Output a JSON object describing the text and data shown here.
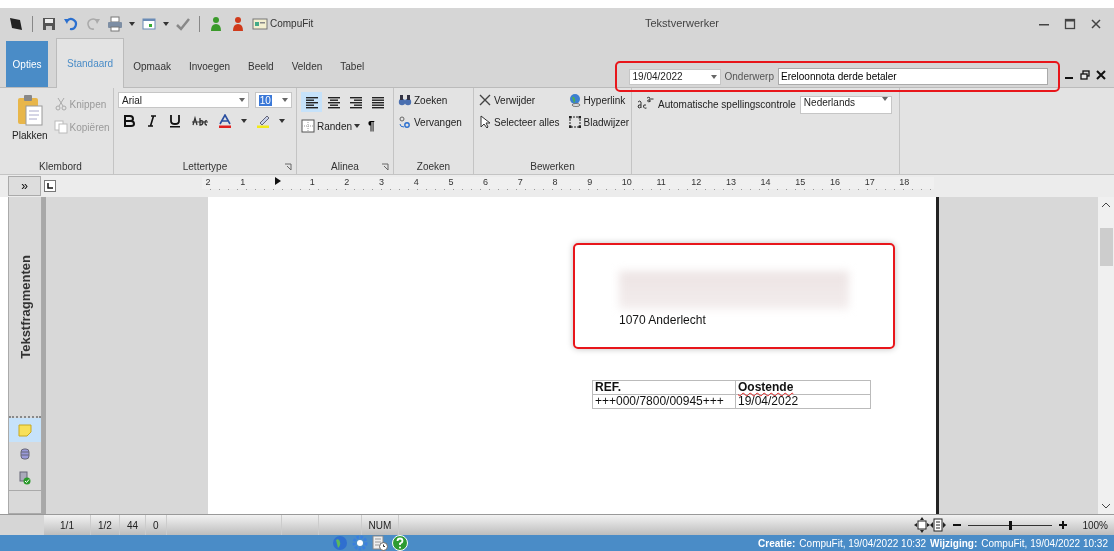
{
  "title_bar": {
    "app_label": "CompuFit",
    "title": "Tekstverwerker"
  },
  "tabs": [
    {
      "label": "Opties",
      "kind": "menu",
      "selected": false
    },
    {
      "label": "Standaard",
      "kind": "tab",
      "selected": true
    },
    {
      "label": "Opmaak",
      "kind": "tab",
      "selected": false
    },
    {
      "label": "Invoegen",
      "kind": "tab",
      "selected": false
    },
    {
      "label": "Beeld",
      "kind": "tab",
      "selected": false
    },
    {
      "label": "Velden",
      "kind": "tab",
      "selected": false
    },
    {
      "label": "Tabel",
      "kind": "tab",
      "selected": false
    }
  ],
  "document_header": {
    "date": "19/04/2022",
    "subject_label": "Onderwerp",
    "subject": "Ereloonnota derde betaler",
    "highlighted": true
  },
  "ribbon": {
    "clipboard": {
      "paste": "Plakken",
      "cut": {
        "label": "Knippen",
        "disabled": true
      },
      "copy": {
        "label": "Kopiëren",
        "disabled": true
      },
      "label": "Klembord"
    },
    "font": {
      "family": "Arial",
      "size": "10",
      "label": "Lettertype"
    },
    "paragraph": {
      "alignments": [
        {
          "kind": "left",
          "selected": true
        },
        {
          "kind": "center",
          "selected": false
        },
        {
          "kind": "right",
          "selected": false
        },
        {
          "kind": "justify",
          "selected": false
        }
      ],
      "borders": "Randen",
      "pilcrow": "¶",
      "label": "Alinea"
    },
    "search": {
      "find": "Zoeken",
      "replace": "Vervangen",
      "label": "Zoeken"
    },
    "edit": {
      "delete": "Verwijder",
      "select_all": "Selecteer alles",
      "hyperlink": "Hyperlink",
      "bookmark": "Bladwijzer",
      "label": "Bewerken"
    },
    "spelling": {
      "label": "Automatische spellingscontrole",
      "language": "Nederlands"
    }
  },
  "ruler": {
    "left_labels": [
      "2",
      "1"
    ],
    "labels": [
      "1",
      "2",
      "3",
      "4",
      "5",
      "6",
      "7",
      "8",
      "9",
      "10",
      "11",
      "12",
      "13",
      "14",
      "15",
      "16",
      "17",
      "18"
    ]
  },
  "side_panel": {
    "toggle": "»",
    "title": "Tekstfragmenten",
    "tools": [
      {
        "kind": "note",
        "selected": true
      },
      {
        "kind": "database",
        "selected": false
      },
      {
        "kind": "approved",
        "selected": false
      }
    ]
  },
  "document": {
    "address_line": "1070 Anderlecht",
    "address_highlighted": true,
    "table": {
      "rows": [
        [
          {
            "text": "REF.",
            "spelling_error": false
          },
          {
            "text": "Oostende",
            "spelling_error": true
          }
        ],
        [
          {
            "text": "+++000/7800/00945+++",
            "spelling_error": false
          },
          {
            "text": "19/04/2022",
            "spelling_error": false
          }
        ]
      ]
    }
  },
  "status_bar": {
    "cells": [
      "1/1",
      "1/2",
      "44",
      "0"
    ],
    "num": "NUM",
    "zoom": {
      "level": 0.5,
      "reading": "100%"
    }
  },
  "footer": {
    "created_label": "Creatie:",
    "created": "CompuFit, 19/04/2022 10:32",
    "modified_label": "Wijziging:",
    "modified": "CompuFit, 19/04/2022 10:32"
  }
}
